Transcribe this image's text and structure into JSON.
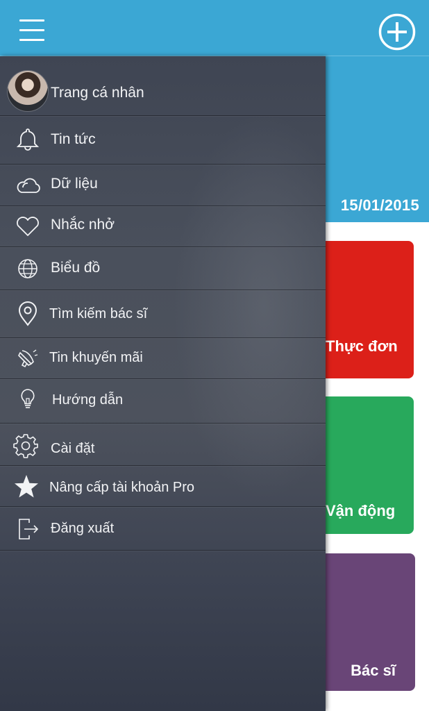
{
  "header": {
    "menu_icon": "hamburger-icon",
    "add_icon": "plus-circle-icon"
  },
  "main": {
    "date": "15/01/2015",
    "tiles": [
      {
        "label": "Thực đơn",
        "color": "#dc2019"
      },
      {
        "label": "Vận động",
        "color": "#28a95c"
      },
      {
        "label": "Bác sĩ",
        "color": "#694577"
      }
    ]
  },
  "colors": {
    "accent": "#3ba7d4",
    "drawer": "#4a505c"
  },
  "drawer": {
    "items": [
      {
        "label": "Trang cá nhân",
        "icon": "avatar"
      },
      {
        "label": "Tin tức",
        "icon": "bell-icon"
      },
      {
        "label": "Dữ liệu",
        "icon": "cloud-icon"
      },
      {
        "label": "Nhắc nhở",
        "icon": "heart-icon"
      },
      {
        "label": "Biểu đồ",
        "icon": "globe-icon"
      },
      {
        "label": "Tìm kiếm bác sĩ",
        "icon": "location-pin-icon"
      },
      {
        "label": "Tin khuyến mãi",
        "icon": "megaphone-icon"
      },
      {
        "label": "Hướng dẫn",
        "icon": "lightbulb-icon"
      },
      {
        "label": "Cài đặt",
        "icon": "gear-icon"
      },
      {
        "label": "Nâng cấp tài khoản Pro",
        "icon": "star-icon"
      },
      {
        "label": "Đăng xuất",
        "icon": "logout-icon"
      }
    ]
  }
}
